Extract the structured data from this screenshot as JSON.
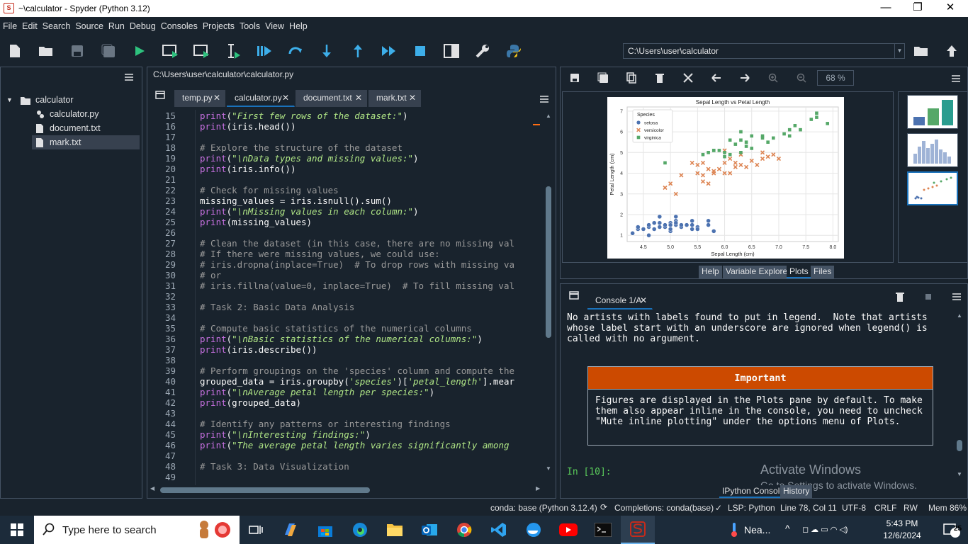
{
  "titlebar": {
    "title": "~\\calculator - Spyder (Python 3.12)",
    "min": "—",
    "max": "❐",
    "close": "✕"
  },
  "menu": [
    "File",
    "Edit",
    "Search",
    "Source",
    "Run",
    "Debug",
    "Consoles",
    "Projects",
    "Tools",
    "View",
    "Help"
  ],
  "toolbar": {
    "path": "C:\\Users\\user\\calculator"
  },
  "files": {
    "root": "calculator",
    "items": [
      "calculator.py",
      "document.txt",
      "mark.txt"
    ]
  },
  "editor": {
    "filepath": "C:\\Users\\user\\calculator\\calculator.py",
    "tabs": [
      "temp.py",
      "calculator.py",
      "document.txt",
      "mark.txt"
    ],
    "lines": [
      {
        "n": "15",
        "t": "print",
        "s": "(\"First few rows of the dataset:\")",
        "k": "ps"
      },
      {
        "n": "16",
        "t": "print(iris.head())",
        "k": "p"
      },
      {
        "n": "17",
        "t": "",
        "k": "e"
      },
      {
        "n": "18",
        "t": "# Explore the structure of the dataset",
        "k": "c"
      },
      {
        "n": "19",
        "t": "print",
        "s": "(\"\\nData types and missing values:\")",
        "k": "ps"
      },
      {
        "n": "20",
        "t": "print(iris.info())",
        "k": "p"
      },
      {
        "n": "21",
        "t": "",
        "k": "e"
      },
      {
        "n": "22",
        "t": "# Check for missing values",
        "k": "c"
      },
      {
        "n": "23",
        "t": "missing_values = iris.isnull().sum()",
        "k": "n"
      },
      {
        "n": "24",
        "t": "print",
        "s": "(\"\\nMissing values in each column:\")",
        "k": "ps"
      },
      {
        "n": "25",
        "t": "print(missing_values)",
        "k": "p"
      },
      {
        "n": "26",
        "t": "",
        "k": "e"
      },
      {
        "n": "27",
        "t": "# Clean the dataset (in this case, there are no missing val",
        "k": "c"
      },
      {
        "n": "28",
        "t": "# If there were missing values, we could use:",
        "k": "c"
      },
      {
        "n": "29",
        "t": "# iris.dropna(inplace=True)  # To drop rows with missing va",
        "k": "c"
      },
      {
        "n": "30",
        "t": "# or",
        "k": "c"
      },
      {
        "n": "31",
        "t": "# iris.fillna(value=0, inplace=True)  # To fill missing val",
        "k": "c"
      },
      {
        "n": "32",
        "t": "",
        "k": "e"
      },
      {
        "n": "33",
        "t": "# Task 2: Basic Data Analysis",
        "k": "c"
      },
      {
        "n": "34",
        "t": "",
        "k": "e"
      },
      {
        "n": "35",
        "t": "# Compute basic statistics of the numerical columns",
        "k": "c"
      },
      {
        "n": "36",
        "t": "print",
        "s": "(\"\\nBasic statistics of the numerical columns:\")",
        "k": "ps"
      },
      {
        "n": "37",
        "t": "print(iris.describe())",
        "k": "p"
      },
      {
        "n": "38",
        "t": "",
        "k": "e"
      },
      {
        "n": "39",
        "t": "# Perform groupings on the 'species' column and compute the",
        "k": "c"
      },
      {
        "n": "40",
        "t": "grouped_data = iris.groupby('species')['petal_length'].mear",
        "k": "n"
      },
      {
        "n": "41",
        "t": "print",
        "s": "(\"\\nAverage petal length per species:\")",
        "k": "ps"
      },
      {
        "n": "42",
        "t": "print(grouped_data)",
        "k": "p"
      },
      {
        "n": "43",
        "t": "",
        "k": "e"
      },
      {
        "n": "44",
        "t": "# Identify any patterns or interesting findings",
        "k": "c"
      },
      {
        "n": "45",
        "t": "print",
        "s": "(\"\\nInteresting findings:\")",
        "k": "ps"
      },
      {
        "n": "46",
        "t": "print",
        "s": "(\"The average petal length varies significantly among",
        "k": "ps"
      },
      {
        "n": "47",
        "t": "",
        "k": "e"
      },
      {
        "n": "48",
        "t": "# Task 3: Data Visualization",
        "k": "c"
      },
      {
        "n": "49",
        "t": "",
        "k": "e"
      }
    ]
  },
  "plots": {
    "zoom": "68 %",
    "tabs": [
      "Help",
      "Variable Explorer",
      "Plots",
      "Files"
    ],
    "active_tab": "Plots"
  },
  "chart_data": {
    "type": "scatter",
    "title": "Sepal Length vs Petal Length",
    "xlabel": "Sepal Length (cm)",
    "ylabel": "Petal Length (cm)",
    "xlim": [
      4.2,
      8.1
    ],
    "ylim": [
      0.7,
      7.2
    ],
    "xticks": [
      "4.5",
      "5.0",
      "5.5",
      "6.0",
      "6.5",
      "7.0",
      "7.5",
      "8.0"
    ],
    "yticks": [
      "1",
      "2",
      "3",
      "4",
      "5",
      "6",
      "7"
    ],
    "legend_title": "Species",
    "legend_position": "top-left",
    "grid": true,
    "series": [
      {
        "name": "setosa",
        "color": "#4c72b0",
        "marker": "circle",
        "x": [
          4.4,
          4.5,
          4.6,
          4.6,
          4.7,
          4.8,
          4.8,
          4.9,
          4.9,
          5.0,
          5.0,
          5.0,
          5.1,
          5.1,
          5.2,
          5.2,
          5.3,
          5.4,
          5.4,
          5.5,
          5.5,
          5.7,
          5.7,
          5.8,
          4.3,
          4.4,
          4.6,
          4.9,
          5.0,
          5.1,
          5.4,
          5.1,
          4.8,
          4.7
        ],
        "y": [
          1.3,
          1.3,
          1.4,
          1.5,
          1.6,
          1.4,
          1.9,
          1.5,
          1.4,
          1.6,
          1.2,
          1.5,
          1.5,
          1.7,
          1.4,
          1.5,
          1.5,
          1.7,
          1.3,
          1.4,
          1.3,
          1.7,
          1.5,
          1.2,
          1.1,
          1.4,
          1.0,
          1.5,
          1.3,
          1.9,
          1.5,
          1.6,
          1.6,
          1.3
        ]
      },
      {
        "name": "versicolor",
        "color": "#dd8452",
        "marker": "x",
        "x": [
          4.9,
          5.0,
          5.1,
          5.2,
          5.5,
          5.5,
          5.6,
          5.6,
          5.7,
          5.7,
          5.8,
          5.8,
          5.9,
          6.0,
          6.0,
          6.1,
          6.1,
          6.2,
          6.2,
          6.3,
          6.3,
          6.4,
          6.5,
          6.6,
          6.7,
          6.7,
          6.8,
          6.9,
          7.0,
          5.4,
          5.6,
          6.0
        ],
        "y": [
          3.3,
          3.5,
          3.0,
          3.9,
          4.0,
          4.4,
          3.9,
          4.5,
          4.2,
          3.5,
          4.0,
          4.1,
          4.2,
          4.0,
          4.5,
          4.7,
          4.0,
          4.3,
          4.5,
          4.9,
          4.4,
          4.3,
          4.6,
          4.4,
          4.7,
          5.0,
          4.8,
          4.9,
          4.7,
          4.5,
          3.6,
          5.1
        ]
      },
      {
        "name": "virginica",
        "color": "#55a868",
        "marker": "square",
        "x": [
          4.9,
          5.6,
          5.7,
          5.8,
          5.8,
          5.9,
          6.0,
          6.0,
          6.1,
          6.2,
          6.3,
          6.3,
          6.4,
          6.4,
          6.5,
          6.5,
          6.7,
          6.7,
          6.8,
          6.9,
          7.1,
          7.2,
          7.2,
          7.3,
          7.4,
          7.6,
          7.7,
          7.7,
          7.9,
          6.1,
          6.3
        ],
        "y": [
          4.5,
          4.9,
          5.0,
          5.1,
          5.1,
          5.1,
          4.8,
          5.0,
          5.6,
          5.4,
          6.0,
          5.6,
          5.3,
          5.5,
          5.8,
          5.2,
          5.8,
          5.7,
          5.5,
          5.7,
          5.9,
          6.1,
          5.8,
          6.3,
          6.1,
          6.6,
          6.7,
          6.9,
          6.4,
          4.9,
          5.0
        ]
      }
    ]
  },
  "console": {
    "tab": "Console 1/A",
    "output": "No artists with labels found to put in legend.  Note that artists whose label start with an underscore are ignored when legend() is called with no argument.",
    "important_title": "Important",
    "important_body": "Figures are displayed in the Plots pane by default. To make them also appear inline in the console, you need to uncheck \"Mute inline plotting\" under the options menu of Plots.",
    "prompt": "In [10]:",
    "tabs": [
      "IPython Console",
      "History"
    ],
    "activate1": "Activate Windows",
    "activate2": "Go to Settings to activate Windows."
  },
  "status": {
    "env": "conda: base (Python 3.12.4)",
    "completions": "Completions: conda(base)",
    "lsp": "LSP: Python",
    "pos": "Line 78, Col 11",
    "enc": "UTF-8",
    "eol": "CRLF",
    "rw": "RW",
    "mem": "Mem 86%"
  },
  "taskbar": {
    "search": "Type here to search",
    "weather": "Nea...",
    "time": "5:43 PM",
    "date": "12/6/2024",
    "notif": "25"
  }
}
